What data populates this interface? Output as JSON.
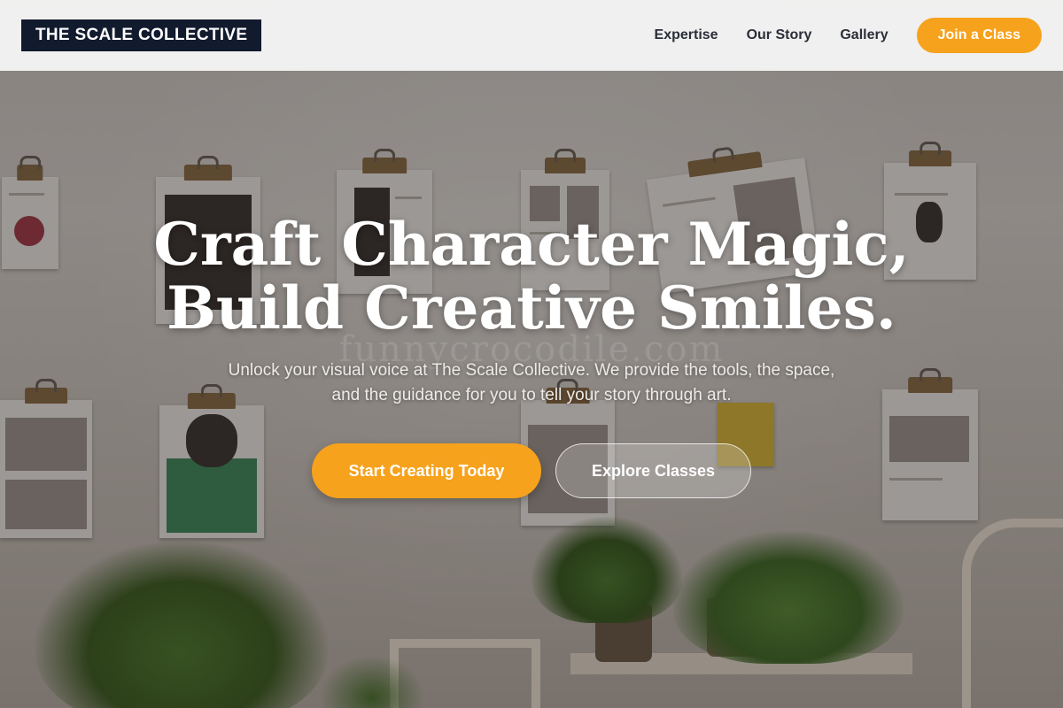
{
  "header": {
    "logo_text": "THE SCALE COLLECTIVE",
    "nav": [
      {
        "label": "Expertise"
      },
      {
        "label": "Our Story"
      },
      {
        "label": "Gallery"
      }
    ],
    "cta_label": "Join a Class"
  },
  "hero": {
    "title_line1": "Craft Character Magic,",
    "title_line2": "Build Creative Smiles.",
    "subtitle": "Unlock your visual voice at The Scale Collective. We provide the tools, the space, and the guidance for you to tell your story through art.",
    "primary_button": "Start Creating Today",
    "secondary_button": "Explore Classes",
    "watermark": "funnycrocodile.com"
  },
  "colors": {
    "accent": "#f6a21c",
    "logo_bg": "#121a2e",
    "header_bg": "#f5f5f5",
    "nav_text": "#2a2e38"
  }
}
